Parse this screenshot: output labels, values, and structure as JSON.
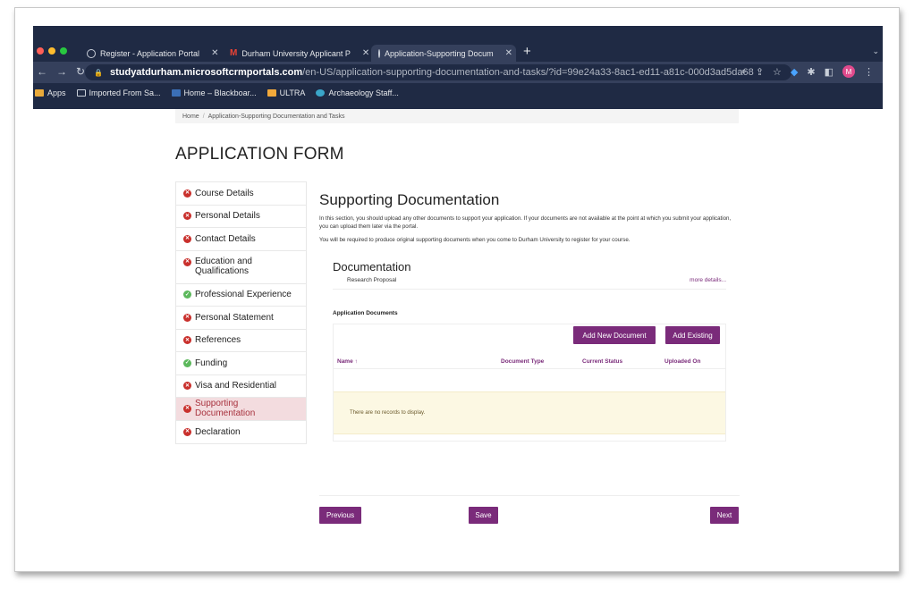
{
  "browser": {
    "tabs": [
      {
        "label": "Register - Application Portal",
        "icon": "globe-icon"
      },
      {
        "label": "Durham University Applicant P",
        "icon": "gmail-icon"
      },
      {
        "label": "Application-Supporting Docum",
        "icon": "globe-icon",
        "active": true
      }
    ],
    "new_tab": "+",
    "url_host": "studyatdurham.microsoftcrmportals.com",
    "url_path": "/en-US/application-supporting-documentation-and-tasks/?id=99e24a33-8ac1-ed11-a81c-000d3ad5da68",
    "avatar_letter": "M",
    "bookmarks": [
      {
        "label": "Apps",
        "color": "#e8a93a"
      },
      {
        "label": "Imported From Sa...",
        "color": "#c9cfd9"
      },
      {
        "label": "Home – Blackboar...",
        "color": "#3b6fb6"
      },
      {
        "label": "ULTRA",
        "color": "#f2a93b"
      },
      {
        "label": "Archaeology Staff...",
        "color": "#3aa6c9"
      }
    ]
  },
  "breadcrumb": {
    "home": "Home",
    "separator": "/",
    "current": "Application-Supporting Documentation and Tasks"
  },
  "page_title": "APPLICATION FORM",
  "sidebar": {
    "items": [
      {
        "label": "Course Details",
        "status": "error"
      },
      {
        "label": "Personal Details",
        "status": "error"
      },
      {
        "label": "Contact Details",
        "status": "error"
      },
      {
        "label": "Education and Qualifications",
        "status": "error"
      },
      {
        "label": "Professional Experience",
        "status": "ok"
      },
      {
        "label": "Personal Statement",
        "status": "error"
      },
      {
        "label": "References",
        "status": "error"
      },
      {
        "label": "Funding",
        "status": "ok"
      },
      {
        "label": "Visa and Residential",
        "status": "error"
      },
      {
        "label": "Supporting Documentation",
        "status": "error",
        "active": true
      },
      {
        "label": "Declaration",
        "status": "error"
      }
    ]
  },
  "main": {
    "title": "Supporting Documentation",
    "intro_1": "In this section, you should upload any other documents to support your application. If your documents are not available at the point at which you submit your application, you can upload them later via the portal.",
    "intro_2": "You will be required to produce original supporting documents when you come to Durham University to register for your course.",
    "documentation_title": "Documentation",
    "document_name": "Research Proposal",
    "more_details": "more details...",
    "app_docs_label": "Application Documents",
    "add_new_label": "Add New Document",
    "add_existing_label": "Add Existing",
    "columns": {
      "name": "Name ↑",
      "type": "Document Type",
      "status": "Current Status",
      "uploaded": "Uploaded On"
    },
    "empty_text": "There are no records to display."
  },
  "footer": {
    "previous": "Previous",
    "save": "Save",
    "next": "Next"
  },
  "colors": {
    "accent": "#7a2b7a",
    "error": "#c9302c",
    "ok": "#5cb85c",
    "active_bg": "#f3dcdf"
  }
}
